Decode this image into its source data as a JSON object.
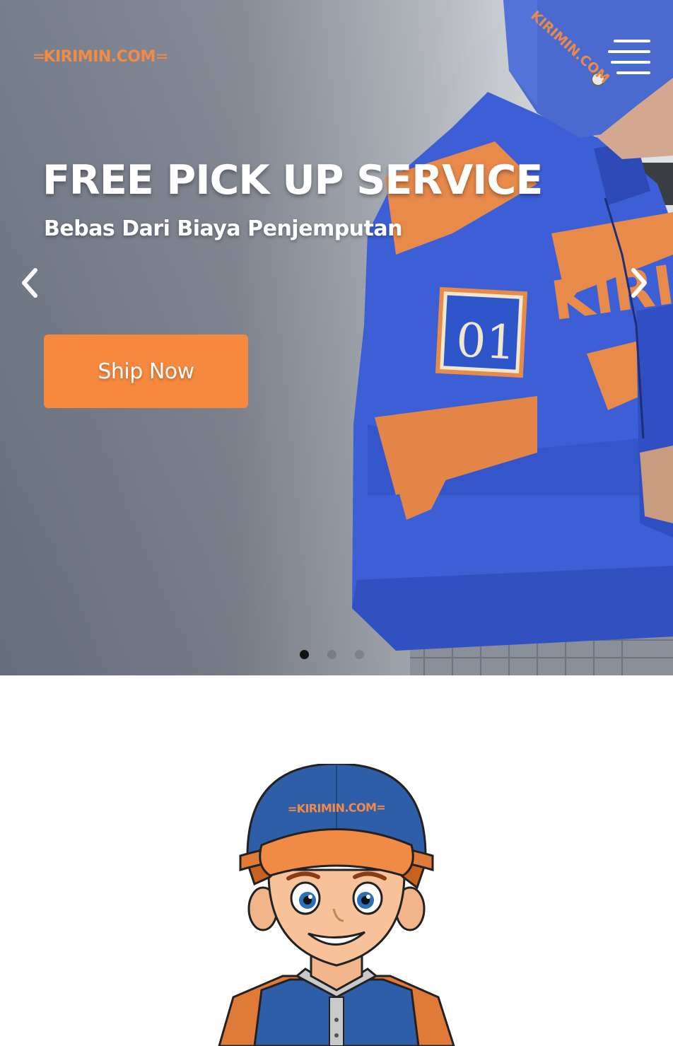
{
  "header": {
    "logo_text": "KIRIMIN.COM",
    "menu_icon": "hamburger-menu-icon"
  },
  "hero": {
    "title": "FREE PICK UP SERVICE",
    "subtitle": "Bebas Dari Biaya Penjemputan",
    "cta_label": "Ship Now",
    "prev_icon": "chevron-left-icon",
    "next_icon": "chevron-right-icon",
    "slides_total": 3,
    "active_slide": 1,
    "courier_badge_number": "01",
    "helmet_text": "KIRIMIN.COM"
  },
  "mascot": {
    "cap_text": "KIRIMIN.COM"
  },
  "colors": {
    "accent_orange": "#f7893f",
    "jacket_blue": "#3d5fd6",
    "text_white": "#ffffff"
  }
}
